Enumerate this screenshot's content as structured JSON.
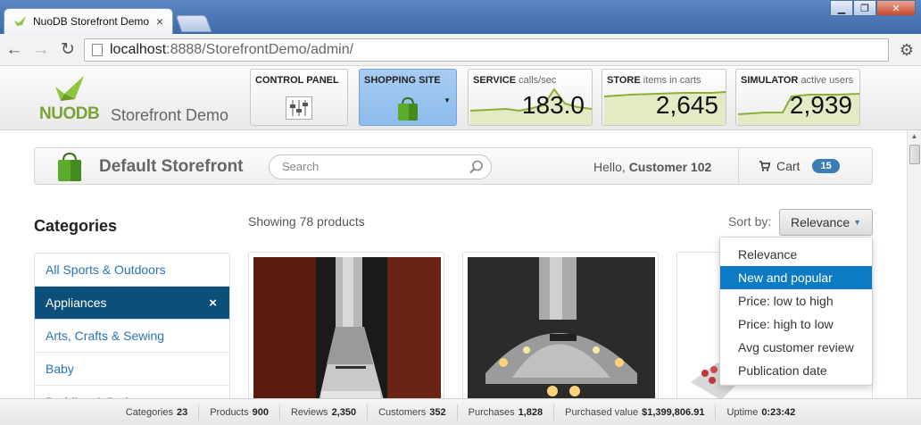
{
  "browser": {
    "tab_title": "NuoDB Storefront Demo",
    "tab_close": "×",
    "url_host": "localhost",
    "url_rest": ":8888/StorefrontDemo/admin/",
    "window_controls": [
      "▁",
      "❐",
      "✕"
    ]
  },
  "admin": {
    "logo_brand": "NUODB",
    "logo_text": "Storefront Demo",
    "panels": {
      "control": {
        "title": "CONTROL PANEL"
      },
      "shopping": {
        "title": "SHOPPING SITE"
      },
      "service": {
        "title": "SERVICE",
        "subtitle": "calls/sec",
        "value": "183.0"
      },
      "store": {
        "title": "STORE",
        "subtitle": "items in carts",
        "value": "2,645"
      },
      "simulator": {
        "title": "SIMULATOR",
        "subtitle": "active users",
        "value": "2,939"
      }
    }
  },
  "storefront": {
    "name": "Default Storefront",
    "search_placeholder": "Search",
    "hello_prefix": "Hello,",
    "customer": "Customer 102",
    "cart_label": "Cart",
    "cart_count": "15"
  },
  "categories": {
    "heading": "Categories",
    "items": [
      {
        "label": "All Sports & Outdoors"
      },
      {
        "label": "Appliances",
        "active": true
      },
      {
        "label": "Arts, Crafts & Sewing"
      },
      {
        "label": "Baby"
      },
      {
        "label": "Bedding & Bath"
      }
    ],
    "remove_glyph": "×"
  },
  "products": {
    "showing": "Showing 78 products",
    "sort_label": "Sort by:",
    "sort_value": "Relevance",
    "sort_options": [
      "Relevance",
      "New and popular",
      "Price: low to high",
      "Price: high to low",
      "Avg customer review",
      "Publication date"
    ],
    "highlighted_option": "New and popular"
  },
  "status": {
    "items": [
      {
        "label": "Categories",
        "value": "23"
      },
      {
        "label": "Products",
        "value": "900"
      },
      {
        "label": "Reviews",
        "value": "2,350"
      },
      {
        "label": "Customers",
        "value": "352"
      },
      {
        "label": "Purchases",
        "value": "1,828"
      },
      {
        "label": "Purchased value",
        "value": "$1,399,806.91"
      },
      {
        "label": "Uptime",
        "value": "0:23:42"
      }
    ]
  },
  "colors": {
    "accent": "#0c4f7b",
    "link": "#2a73b7",
    "highlight": "#0d7ac4",
    "brand_green": "#7aa238",
    "selected_panel": "#9cc4ef"
  }
}
